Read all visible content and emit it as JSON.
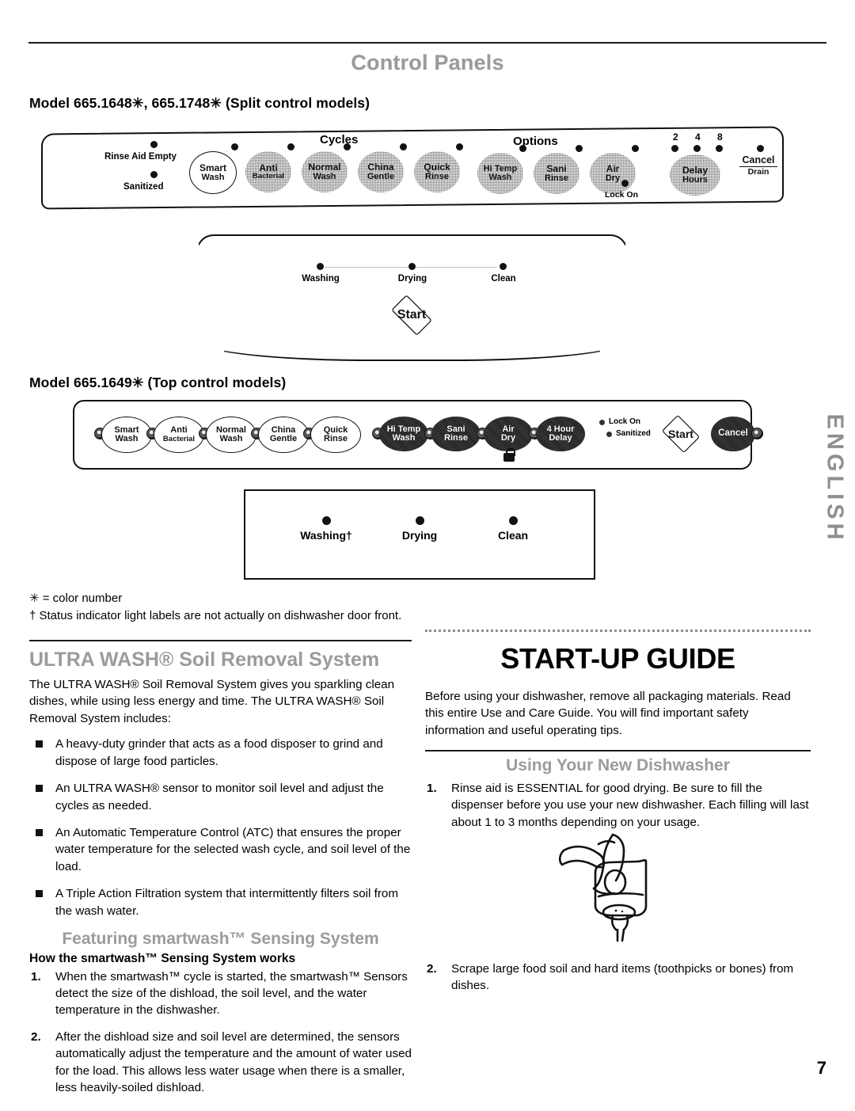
{
  "header": {
    "section_title": "Control Panels",
    "page_number": "7",
    "side_tab": "ENGLISH"
  },
  "panels": {
    "split": {
      "label": "Model 665.1648✳, 665.1748✳ (Split control models)",
      "indicators": [
        {
          "name": "rinse-aid-empty",
          "label": "Rinse Aid Empty"
        },
        {
          "name": "sanitized",
          "label": "Sanitized"
        }
      ],
      "group_cycles": "Cycles",
      "group_options": "Options",
      "cycle_buttons": [
        {
          "line1": "Smart",
          "line2": "Wash"
        },
        {
          "line1": "Anti",
          "line2": "Bacterial"
        },
        {
          "line1": "Normal",
          "line2": "Wash"
        },
        {
          "line1": "China",
          "line2": "Gentle"
        },
        {
          "line1": "Quick",
          "line2": "Rinse"
        }
      ],
      "option_buttons": [
        {
          "line1": "Hi Temp",
          "line2": "Wash"
        },
        {
          "line1": "Sani",
          "line2": "Rinse"
        },
        {
          "line1": "Air",
          "line2": "Dry"
        }
      ],
      "lock_on_label": "Lock On",
      "delay_hours": {
        "ticks": [
          "2",
          "4",
          "8"
        ],
        "line1": "Delay",
        "line2": "Hours"
      },
      "cancel": {
        "line1": "Cancel",
        "line2": "Drain"
      }
    },
    "status_split": {
      "lights": [
        "Washing",
        "Drying",
        "Clean"
      ],
      "start_label": "Start"
    },
    "top": {
      "label": "Model 665.1649✳ (Top control models)",
      "cycle_buttons": [
        {
          "line1": "Smart",
          "line2": "Wash"
        },
        {
          "line1": "Anti",
          "line2": "Bacterial"
        },
        {
          "line1": "Normal",
          "line2": "Wash"
        },
        {
          "line1": "China",
          "line2": "Gentle"
        },
        {
          "line1": "Quick",
          "line2": "Rinse"
        }
      ],
      "option_buttons": [
        {
          "line1": "Hi Temp",
          "line2": "Wash"
        },
        {
          "line1": "Sani",
          "line2": "Rinse"
        },
        {
          "line1": "Air",
          "line2": "Dry"
        },
        {
          "line1": "4 Hour",
          "line2": "Delay"
        }
      ],
      "status_lights": [
        "Lock On",
        "Sanitized"
      ],
      "start_label": "Start",
      "cancel_label": "Cancel"
    },
    "status_top": {
      "lights": [
        "Washing†",
        "Drying",
        "Clean"
      ]
    }
  },
  "footnotes": {
    "color_number": "✳ = color number",
    "status_labels": "† Status indicator light labels are not actually on dishwasher door front."
  },
  "left_column": {
    "ultra_wash": {
      "heading": "ULTRA WASH® Soil Removal System",
      "intro": "The ULTRA WASH® Soil Removal System gives you sparkling clean dishes, while using less energy and time. The ULTRA WASH® Soil Removal System includes:",
      "bullets": [
        "A heavy-duty grinder that acts as a food disposer to grind and dispose of large food particles.",
        "An ULTRA WASH® sensor to monitor soil level and adjust the cycles as needed.",
        "An Automatic Temperature Control (ATC) that ensures the proper water temperature for the selected wash cycle, and soil level of the load.",
        "A Triple Action Filtration system that intermittently filters soil from the wash water."
      ]
    },
    "smartwash": {
      "heading": "Featuring smartwash™ Sensing System",
      "subhead": "How the smartwash™ Sensing System works",
      "steps": [
        {
          "n": "1.",
          "text": "When the smartwash™ cycle is started, the smartwash™ Sensors detect the size of the dishload, the soil level, and the water temperature in the dishwasher."
        },
        {
          "n": "2.",
          "text": "After the dishload size and soil level are determined, the sensors automatically adjust the temperature and the amount of water used for the load. This allows less water usage when there is a smaller, less heavily-soiled dishload."
        }
      ]
    }
  },
  "right_column": {
    "title": "START-UP GUIDE",
    "intro": "Before using your dishwasher, remove all packaging materials. Read this entire Use and Care Guide. You will find important safety information and useful operating tips.",
    "using_heading": "Using Your New Dishwasher",
    "steps": [
      {
        "n": "1.",
        "text": "Rinse aid is ESSENTIAL for good drying. Be sure to fill the dispenser before you use your new dishwasher. Each filling will last about 1 to 3 months depending on your usage."
      },
      {
        "n": "2.",
        "text": "Scrape large food soil and hard items (toothpicks or bones) from dishes."
      }
    ],
    "illustration": "hand-squeezing-rinse-aid-bottle"
  }
}
